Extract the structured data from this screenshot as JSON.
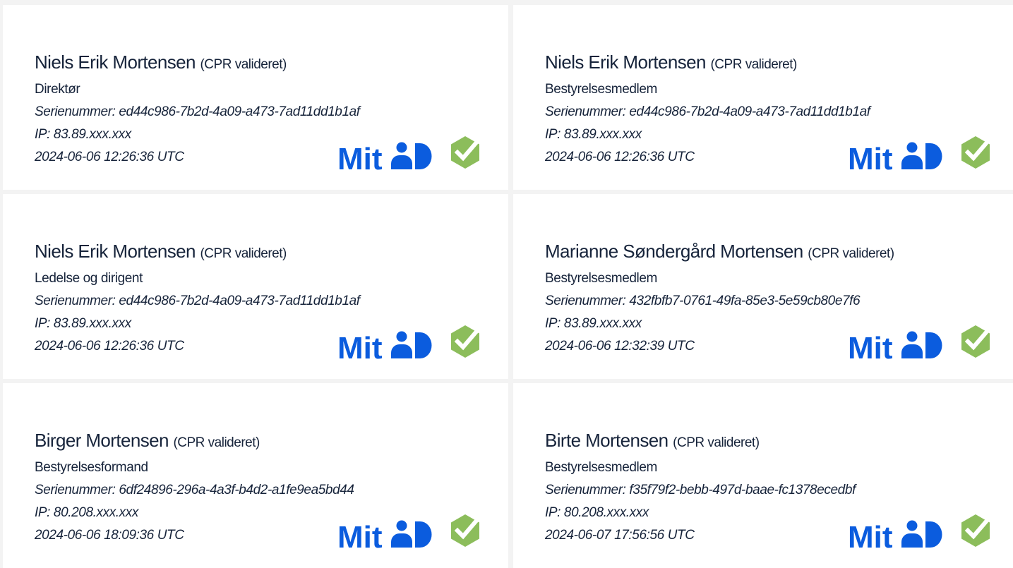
{
  "brand": {
    "mitid_color": "#0b5cde",
    "check_color": "#8cbd5b",
    "text_color": "#16233a",
    "mitid_label": "MitID"
  },
  "signatures": [
    {
      "name": "Niels Erik Mortensen",
      "cpr": "(CPR valideret)",
      "role": "Direktør",
      "serial": "Serienummer: ed44c986-7b2d-4a09-a473-7ad11dd1b1af",
      "ip": "IP: 83.89.xxx.xxx",
      "timestamp": "2024-06-06 12:26:36 UTC"
    },
    {
      "name": "Niels Erik Mortensen",
      "cpr": "(CPR valideret)",
      "role": "Bestyrelsesmedlem",
      "serial": "Serienummer: ed44c986-7b2d-4a09-a473-7ad11dd1b1af",
      "ip": "IP: 83.89.xxx.xxx",
      "timestamp": "2024-06-06 12:26:36 UTC"
    },
    {
      "name": "Niels Erik Mortensen",
      "cpr": "(CPR valideret)",
      "role": "Ledelse og dirigent",
      "serial": "Serienummer: ed44c986-7b2d-4a09-a473-7ad11dd1b1af",
      "ip": "IP: 83.89.xxx.xxx",
      "timestamp": "2024-06-06 12:26:36 UTC"
    },
    {
      "name": "Marianne Søndergård Mortensen",
      "cpr": "(CPR valideret)",
      "role": "Bestyrelsesmedlem",
      "serial": "Serienummer: 432fbfb7-0761-49fa-85e3-5e59cb80e7f6",
      "ip": "IP: 83.89.xxx.xxx",
      "timestamp": "2024-06-06 12:32:39 UTC"
    },
    {
      "name": "Birger Mortensen",
      "cpr": "(CPR valideret)",
      "role": "Bestyrelsesformand",
      "serial": "Serienummer: 6df24896-296a-4a3f-b4d2-a1fe9ea5bd44",
      "ip": "IP: 80.208.xxx.xxx",
      "timestamp": "2024-06-06 18:09:36 UTC"
    },
    {
      "name": "Birte Mortensen",
      "cpr": "(CPR valideret)",
      "role": "Bestyrelsesmedlem",
      "serial": "Serienummer: f35f79f2-bebb-497d-baae-fc1378ecedbf",
      "ip": "IP: 80.208.xxx.xxx",
      "timestamp": "2024-06-07 17:56:56 UTC"
    }
  ]
}
